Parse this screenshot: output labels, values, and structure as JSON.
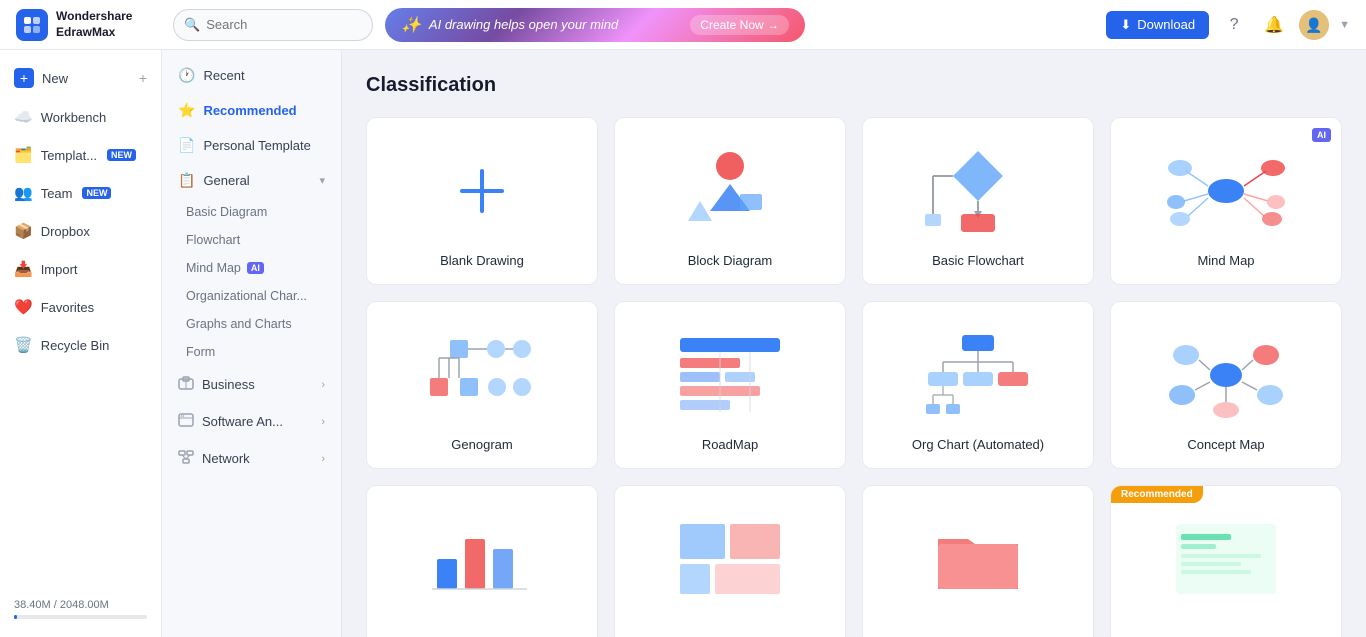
{
  "app": {
    "name": "Wondershare",
    "subname": "EdrawMax"
  },
  "topbar": {
    "search_placeholder": "Search",
    "ai_banner_text": "AI drawing helps open your mind",
    "ai_banner_cta": "Create Now →",
    "download_label": "Download",
    "question_icon": "?",
    "bell_icon": "🔔"
  },
  "sidebar": {
    "items": [
      {
        "id": "new",
        "label": "New",
        "icon": "➕",
        "badge": ""
      },
      {
        "id": "workbench",
        "label": "Workbench",
        "icon": "☁️",
        "badge": ""
      },
      {
        "id": "templates",
        "label": "Templat...",
        "icon": "🗂️",
        "badge": "NEW"
      },
      {
        "id": "team",
        "label": "Team",
        "icon": "👥",
        "badge": "NEW"
      },
      {
        "id": "dropbox",
        "label": "Dropbox",
        "icon": "📦",
        "badge": ""
      },
      {
        "id": "import",
        "label": "Import",
        "icon": "📥",
        "badge": ""
      },
      {
        "id": "favorites",
        "label": "Favorites",
        "icon": "❤️",
        "badge": ""
      },
      {
        "id": "recycle-bin",
        "label": "Recycle Bin",
        "icon": "🗑️",
        "badge": ""
      }
    ],
    "storage_text": "38.40M / 2048.00M"
  },
  "nav_panel": {
    "items": [
      {
        "id": "recent",
        "label": "Recent",
        "icon": "🕐",
        "type": "item"
      },
      {
        "id": "recommended",
        "label": "Recommended",
        "icon": "⭐",
        "type": "item",
        "active": true
      },
      {
        "id": "personal-template",
        "label": "Personal Template",
        "icon": "📄",
        "type": "item"
      },
      {
        "id": "general",
        "label": "General",
        "icon": "📋",
        "type": "section",
        "expanded": true,
        "children": [
          {
            "id": "basic-diagram",
            "label": "Basic Diagram"
          },
          {
            "id": "flowchart",
            "label": "Flowchart"
          },
          {
            "id": "mind-map",
            "label": "Mind Map",
            "ai": true
          },
          {
            "id": "org-chart",
            "label": "Organizational Char..."
          },
          {
            "id": "graphs-charts",
            "label": "Graphs and Charts"
          },
          {
            "id": "form",
            "label": "Form"
          }
        ]
      },
      {
        "id": "business",
        "label": "Business",
        "icon": "💼",
        "type": "section",
        "expanded": false
      },
      {
        "id": "software-an",
        "label": "Software An...",
        "icon": "🖥️",
        "type": "section",
        "expanded": false
      },
      {
        "id": "network",
        "label": "Network",
        "icon": "🌐",
        "type": "section",
        "expanded": false
      }
    ]
  },
  "content": {
    "title": "Classification",
    "cards": [
      {
        "id": "blank",
        "label": "Blank Drawing",
        "type": "blank",
        "ai": false,
        "recommended": false
      },
      {
        "id": "block-diagram",
        "label": "Block Diagram",
        "type": "block",
        "ai": false,
        "recommended": false
      },
      {
        "id": "basic-flowchart",
        "label": "Basic Flowchart",
        "type": "flowchart",
        "ai": false,
        "recommended": false
      },
      {
        "id": "mind-map",
        "label": "Mind Map",
        "type": "mindmap",
        "ai": true,
        "recommended": false
      },
      {
        "id": "genogram",
        "label": "Genogram",
        "type": "genogram",
        "ai": false,
        "recommended": false
      },
      {
        "id": "roadmap",
        "label": "RoadMap",
        "type": "roadmap",
        "ai": false,
        "recommended": false
      },
      {
        "id": "org-chart-auto",
        "label": "Org Chart (Automated)",
        "type": "orgchart",
        "ai": false,
        "recommended": false
      },
      {
        "id": "concept-map",
        "label": "Concept Map",
        "type": "conceptmap",
        "ai": false,
        "recommended": false
      },
      {
        "id": "card1",
        "label": "",
        "type": "bar",
        "ai": false,
        "recommended": false
      },
      {
        "id": "card2",
        "label": "",
        "type": "treemap",
        "ai": false,
        "recommended": false
      },
      {
        "id": "card3",
        "label": "",
        "type": "folder",
        "ai": false,
        "recommended": false
      },
      {
        "id": "card4",
        "label": "",
        "type": "recommended-card",
        "ai": false,
        "recommended": true
      }
    ]
  }
}
